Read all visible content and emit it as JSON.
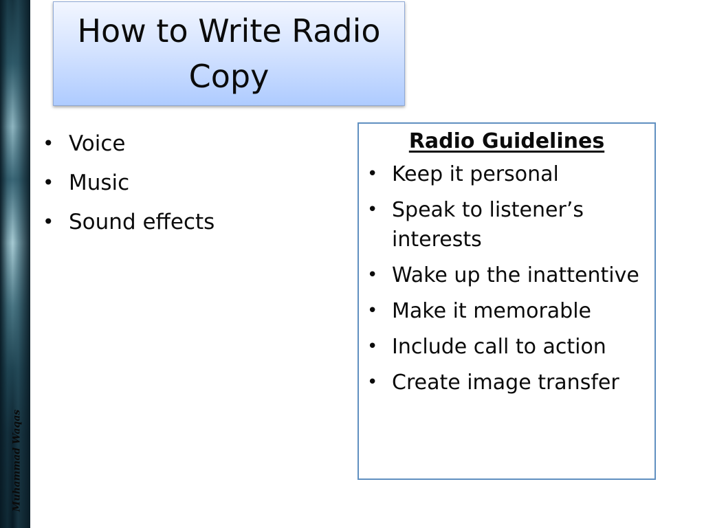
{
  "slide": {
    "title": "How to Write Radio Copy",
    "author": "Muhammad Waqas",
    "left_list": [
      "Voice",
      "Music",
      "Sound effects"
    ],
    "guidelines": {
      "heading": "Radio Guidelines",
      "items": [
        "Keep it personal",
        "Speak to listener’s interests",
        "Wake up the inattentive",
        "Make it memorable",
        "Include call to action",
        "Create image transfer"
      ]
    }
  },
  "colors": {
    "title_gradient_top": "#f2f6ff",
    "title_gradient_bottom": "#aecbff",
    "guide_box_border": "#5f8fc0",
    "side_strip_dark": "#081a24",
    "side_strip_light": "#a7cbd4"
  }
}
